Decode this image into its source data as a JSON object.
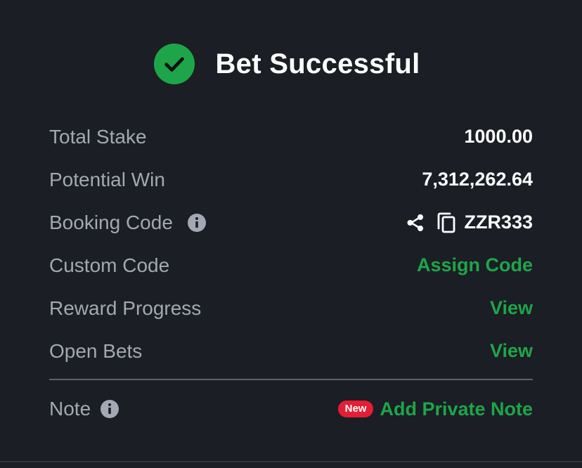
{
  "header": {
    "title": "Bet Successful"
  },
  "rows": {
    "total_stake": {
      "label": "Total Stake",
      "value": "1000.00"
    },
    "potential_win": {
      "label": "Potential Win",
      "value": "7,312,262.64"
    },
    "booking_code": {
      "label": "Booking Code",
      "value": "ZZR333"
    },
    "custom_code": {
      "label": "Custom Code",
      "action": "Assign Code"
    },
    "reward_progress": {
      "label": "Reward Progress",
      "action": "View"
    },
    "open_bets": {
      "label": "Open Bets",
      "action": "View"
    }
  },
  "note": {
    "label": "Note",
    "badge": "New",
    "action": "Add Private Note"
  },
  "colors": {
    "background": "#1b1e24",
    "accent_green": "#1ea54a",
    "badge_red": "#e41e34",
    "label_gray": "#a3a8b2"
  },
  "icons": {
    "success": "check-circle-icon",
    "info": "info-icon",
    "share": "share-icon",
    "copy": "copy-icon"
  }
}
